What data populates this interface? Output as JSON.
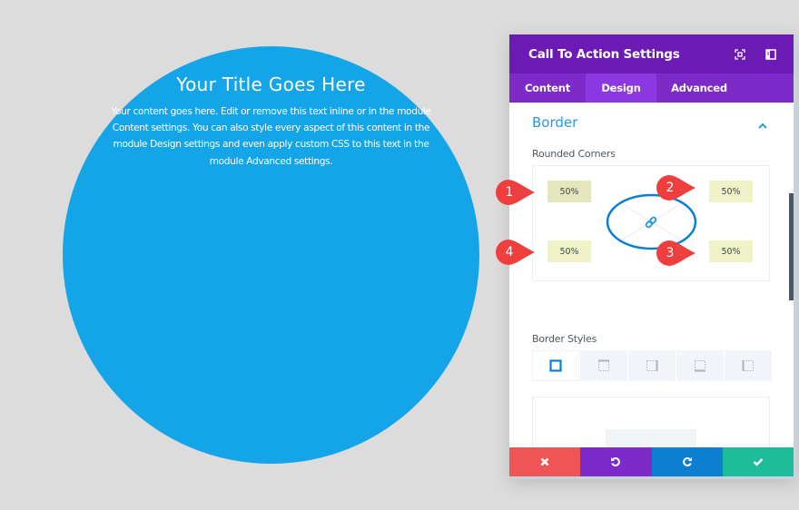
{
  "canvas": {
    "module_bg_color": "#14a5e9",
    "title": "Your Title Goes Here",
    "body": "Your content goes here. Edit or remove this text inline or in the module Content settings. You can also style every aspect of this content in the module Design settings and even apply custom CSS to this text in the module Advanced settings."
  },
  "panel": {
    "title": "Call To Action Settings",
    "header_icons": [
      "expand-icon",
      "sidebar-toggle-icon"
    ],
    "tabs": [
      {
        "label": "Content",
        "active": false
      },
      {
        "label": "Design",
        "active": true
      },
      {
        "label": "Advanced",
        "active": false
      }
    ],
    "section": {
      "title": "Border",
      "expanded": true
    },
    "rounded_corners": {
      "label": "Rounded Corners",
      "top_left": "50%",
      "top_right": "50%",
      "bottom_right": "50%",
      "bottom_left": "50%",
      "linked_icon": "link-icon"
    },
    "annotations": [
      "1",
      "2",
      "3",
      "4"
    ],
    "border_styles": {
      "label": "Border Styles",
      "options": [
        "all-sides",
        "top",
        "right",
        "bottom",
        "left"
      ],
      "selected": "all-sides"
    },
    "footer": {
      "cancel": {
        "icon": "close-icon",
        "color": "#ef5555"
      },
      "undo": {
        "icon": "undo-icon",
        "color": "#7d2ac9"
      },
      "redo": {
        "icon": "redo-icon",
        "color": "#0c7fd1"
      },
      "save": {
        "icon": "check-icon",
        "color": "#1ebc9b"
      }
    }
  }
}
